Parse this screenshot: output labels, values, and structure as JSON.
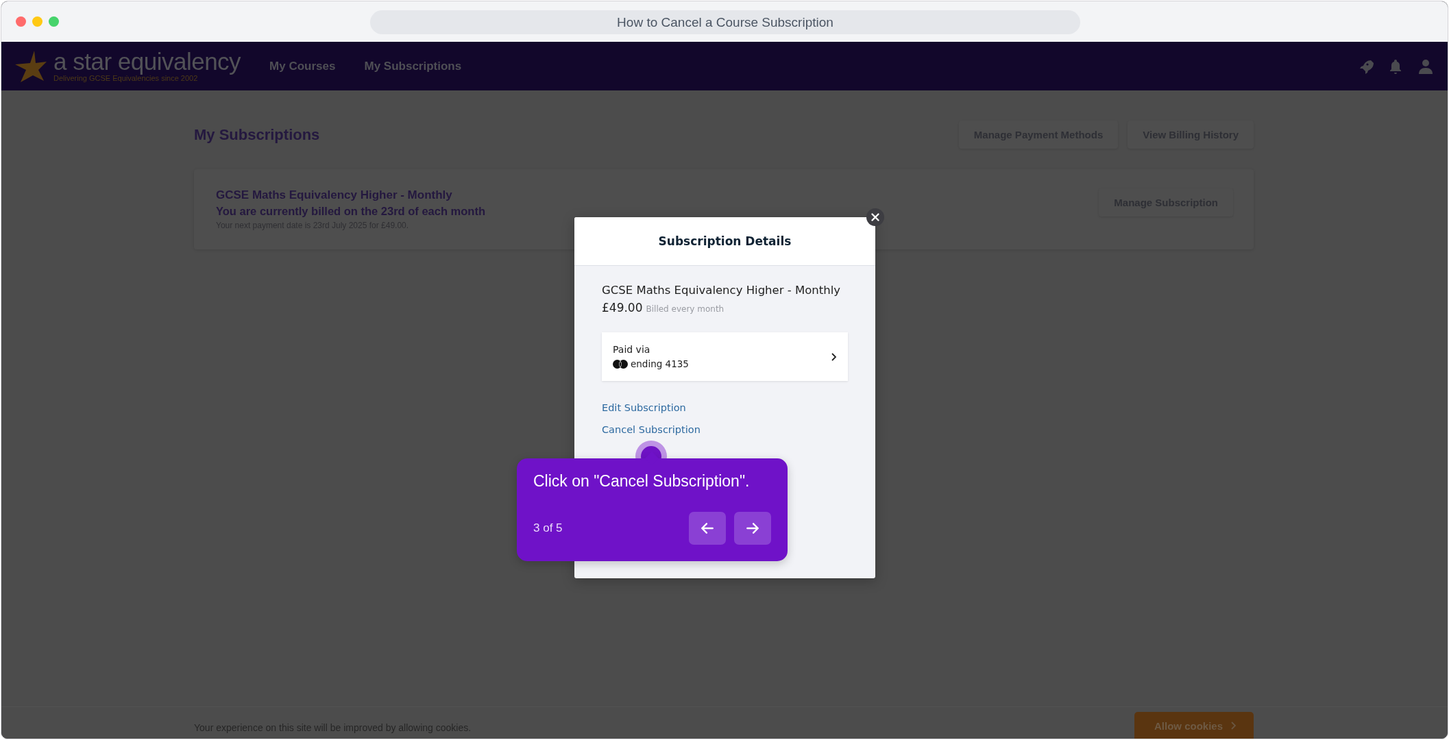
{
  "window": {
    "title": "How to Cancel a Course Subscription"
  },
  "nav": {
    "logo": {
      "name": "a star equivalency",
      "tagline": "Delivering GCSE Equivalencies since 2002"
    },
    "links": [
      {
        "label": "My Courses"
      },
      {
        "label": "My Subscriptions"
      }
    ]
  },
  "page": {
    "title": "My Subscriptions",
    "actions": [
      "Manage Payment Methods",
      "View Billing History"
    ]
  },
  "subscriptions": [
    {
      "name": "GCSE Maths Equivalency Higher - Monthly",
      "billing": "You are currently billed on the 23rd of each month",
      "next_payment": "Your next payment date is 23rd July 2025 for £49.00.",
      "action": "Manage Subscription"
    }
  ],
  "modal": {
    "title": "Subscription Details",
    "plan": "GCSE Maths Equivalency Higher - Monthly",
    "price": "£49.00",
    "period": "Billed every month",
    "payment": {
      "label": "Paid via",
      "card": "ending 4135"
    },
    "links": [
      "Edit Subscription",
      "Cancel Subscription"
    ]
  },
  "guide": {
    "text": "Click on \"Cancel Subscription\".",
    "step": "3 of 5"
  },
  "cookie_bar": {
    "text": "Your experience on this site will be improved by allowing cookies.",
    "button": "Allow cookies"
  }
}
